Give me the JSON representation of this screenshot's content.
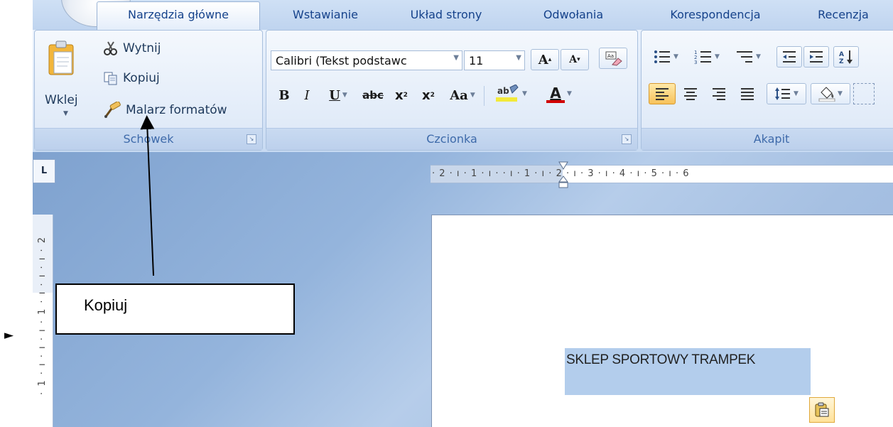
{
  "tabs": [
    "Narzędzia główne",
    "Wstawianie",
    "Układ strony",
    "Odwołania",
    "Korespondencja",
    "Recenzja"
  ],
  "clipboard": {
    "paste_label": "Wklej",
    "cut_label": "Wytnij",
    "copy_label": "Kopiuj",
    "format_painter_label": "Malarz formatów",
    "group_label": "Schowek"
  },
  "font": {
    "font_name": "Calibri (Tekst podstawc",
    "font_size": "11",
    "bold": "B",
    "italic": "I",
    "underline": "U",
    "strike": "abc",
    "subscript": "x",
    "superscript": "x",
    "change_case": "Aa",
    "font_color": "A",
    "grow": "A",
    "shrink": "A",
    "group_label": "Czcionka"
  },
  "paragraph": {
    "group_label": "Akapit"
  },
  "ruler": {
    "horizontal": "· 2 · ı · 1 · ı ·   · ı · 1 · ı · 2 · ı · 3 · ı · 4 · ı · 5 · ı · 6",
    "vertical": "· 1 · ı · ı · ı · 1 · ı · ı · ı · 2"
  },
  "document": {
    "selected_text": "SKLEP SPORTOWY TRAMPEK"
  },
  "annotation": {
    "callout_text": "Kopiuj",
    "marker": "►"
  },
  "colors": {
    "tab_text": "#15428b",
    "selection": "#b3cdec",
    "group_label": "#3e6aaa"
  }
}
